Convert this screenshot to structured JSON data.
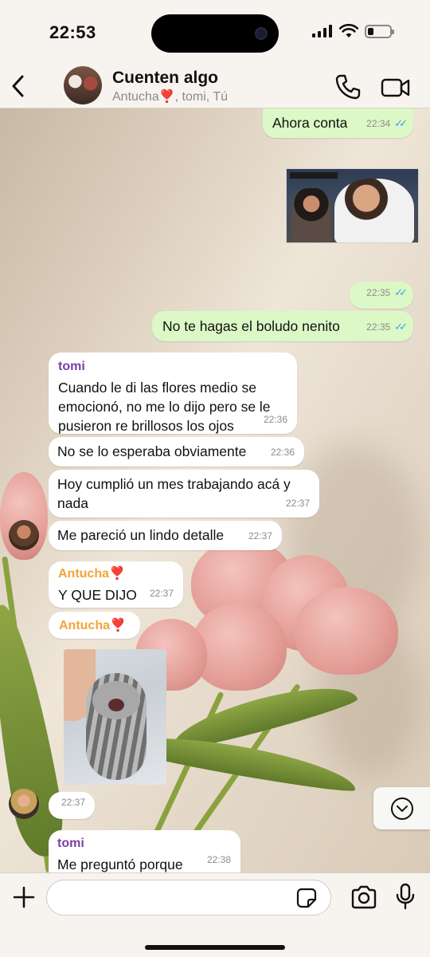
{
  "status_bar": {
    "time": "22:53",
    "battery_level": 0.25
  },
  "header": {
    "group_name": "Cuenten algo",
    "members_prefix": "Antucha",
    "members_heart": "❣️",
    "members_suffix": ", tomi, Tú"
  },
  "messages": [
    {
      "id": "m1",
      "direction": "out",
      "text": "Ahora conta",
      "time": "22:34",
      "read": true
    },
    {
      "id": "m2",
      "direction": "out",
      "type": "photo",
      "description_icon": "photo-stadium-icon"
    },
    {
      "id": "m3",
      "direction": "out",
      "text": "",
      "time": "22:35",
      "read": true
    },
    {
      "id": "m4",
      "direction": "out",
      "text": "No te hagas el boludo nenito",
      "time": "22:35",
      "read": true
    },
    {
      "id": "m5",
      "direction": "in",
      "sender": "tomi",
      "text": "Cuando le di las flores medio se emocionó, no me lo dijo pero se le pusieron re brillosos los ojos",
      "time": "22:36"
    },
    {
      "id": "m6",
      "direction": "in",
      "text": "No se lo esperaba obviamente",
      "time": "22:36"
    },
    {
      "id": "m7",
      "direction": "in",
      "text": "Hoy cumplió un mes trabajando acá y nada",
      "time": "22:37"
    },
    {
      "id": "m8",
      "direction": "in",
      "text": "Me pareció un lindo detalle",
      "time": "22:37"
    },
    {
      "id": "m9",
      "direction": "in",
      "sender": "Antucha",
      "sender_heart": "❣️",
      "text": "Y QUE DIJO",
      "time": "22:37"
    },
    {
      "id": "m10",
      "direction": "in",
      "sender": "Antucha",
      "sender_heart": "❣️",
      "type": "sticker"
    },
    {
      "id": "m11",
      "direction": "in",
      "text": "",
      "time": "22:37"
    },
    {
      "id": "m12",
      "direction": "in",
      "sender": "tomi",
      "text": "Me preguntó porque",
      "time": "22:38"
    }
  ],
  "ticks": "✓✓",
  "input": {
    "placeholder": ""
  },
  "colors": {
    "outgoing_bubble": "#dcf8c6",
    "incoming_bubble": "#ffffff",
    "tomi_name": "#7b3fa5",
    "antucha_name": "#f2a43a",
    "read_ticks": "#35a1f3"
  }
}
